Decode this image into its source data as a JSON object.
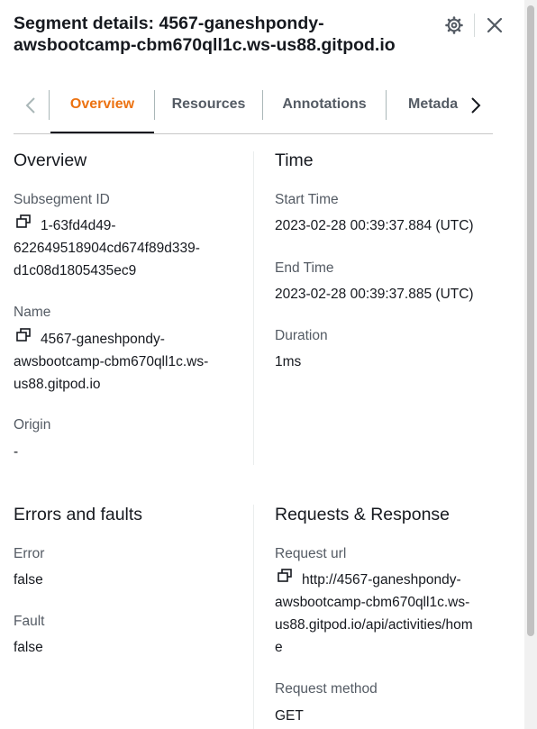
{
  "header": {
    "title_line1": "Segment details: 4567-ganeshpondy-",
    "title_line2": "awsbootcamp-cbm670qll1c.ws-us88.gitpod.io"
  },
  "tabs": [
    {
      "label": "Overview",
      "active": true
    },
    {
      "label": "Resources",
      "active": false
    },
    {
      "label": "Annotations",
      "active": false
    },
    {
      "label": "Metada",
      "active": false
    }
  ],
  "overview": {
    "title": "Overview",
    "subsegment_id_label": "Subsegment ID",
    "subsegment_id_line1": "1-63fd4d49-",
    "subsegment_id_line2": "622649518904cd674f89d339-",
    "subsegment_id_line3": "d1c08d1805435ec9",
    "name_label": "Name",
    "name_line1": "4567-ganeshpondy-",
    "name_line2": "awsbootcamp-cbm670qll1c.ws-",
    "name_line3": "us88.gitpod.io",
    "origin_label": "Origin",
    "origin_value": "-"
  },
  "time": {
    "title": "Time",
    "start_label": "Start Time",
    "start_value": "2023-02-28 00:39:37.884 (UTC)",
    "end_label": "End Time",
    "end_value": "2023-02-28 00:39:37.885 (UTC)",
    "duration_label": "Duration",
    "duration_value": "1ms"
  },
  "errors": {
    "title": "Errors and faults",
    "error_label": "Error",
    "error_value": "false",
    "fault_label": "Fault",
    "fault_value": "false"
  },
  "requests": {
    "title": "Requests & Response",
    "url_label": "Request url",
    "url_line1": "http://4567-ganeshpondy-",
    "url_line2": "awsbootcamp-cbm670qll1c.ws-",
    "url_line3": "us88.gitpod.io/api/activities/hom",
    "url_line4": "e",
    "method_label": "Request method",
    "method_value": "GET"
  },
  "colors": {
    "accent": "#ec7211",
    "text": "#16191f",
    "muted": "#545b64"
  },
  "icons": [
    "gear-icon",
    "close-icon",
    "chevron-left-icon",
    "chevron-right-icon",
    "copy-icon"
  ]
}
